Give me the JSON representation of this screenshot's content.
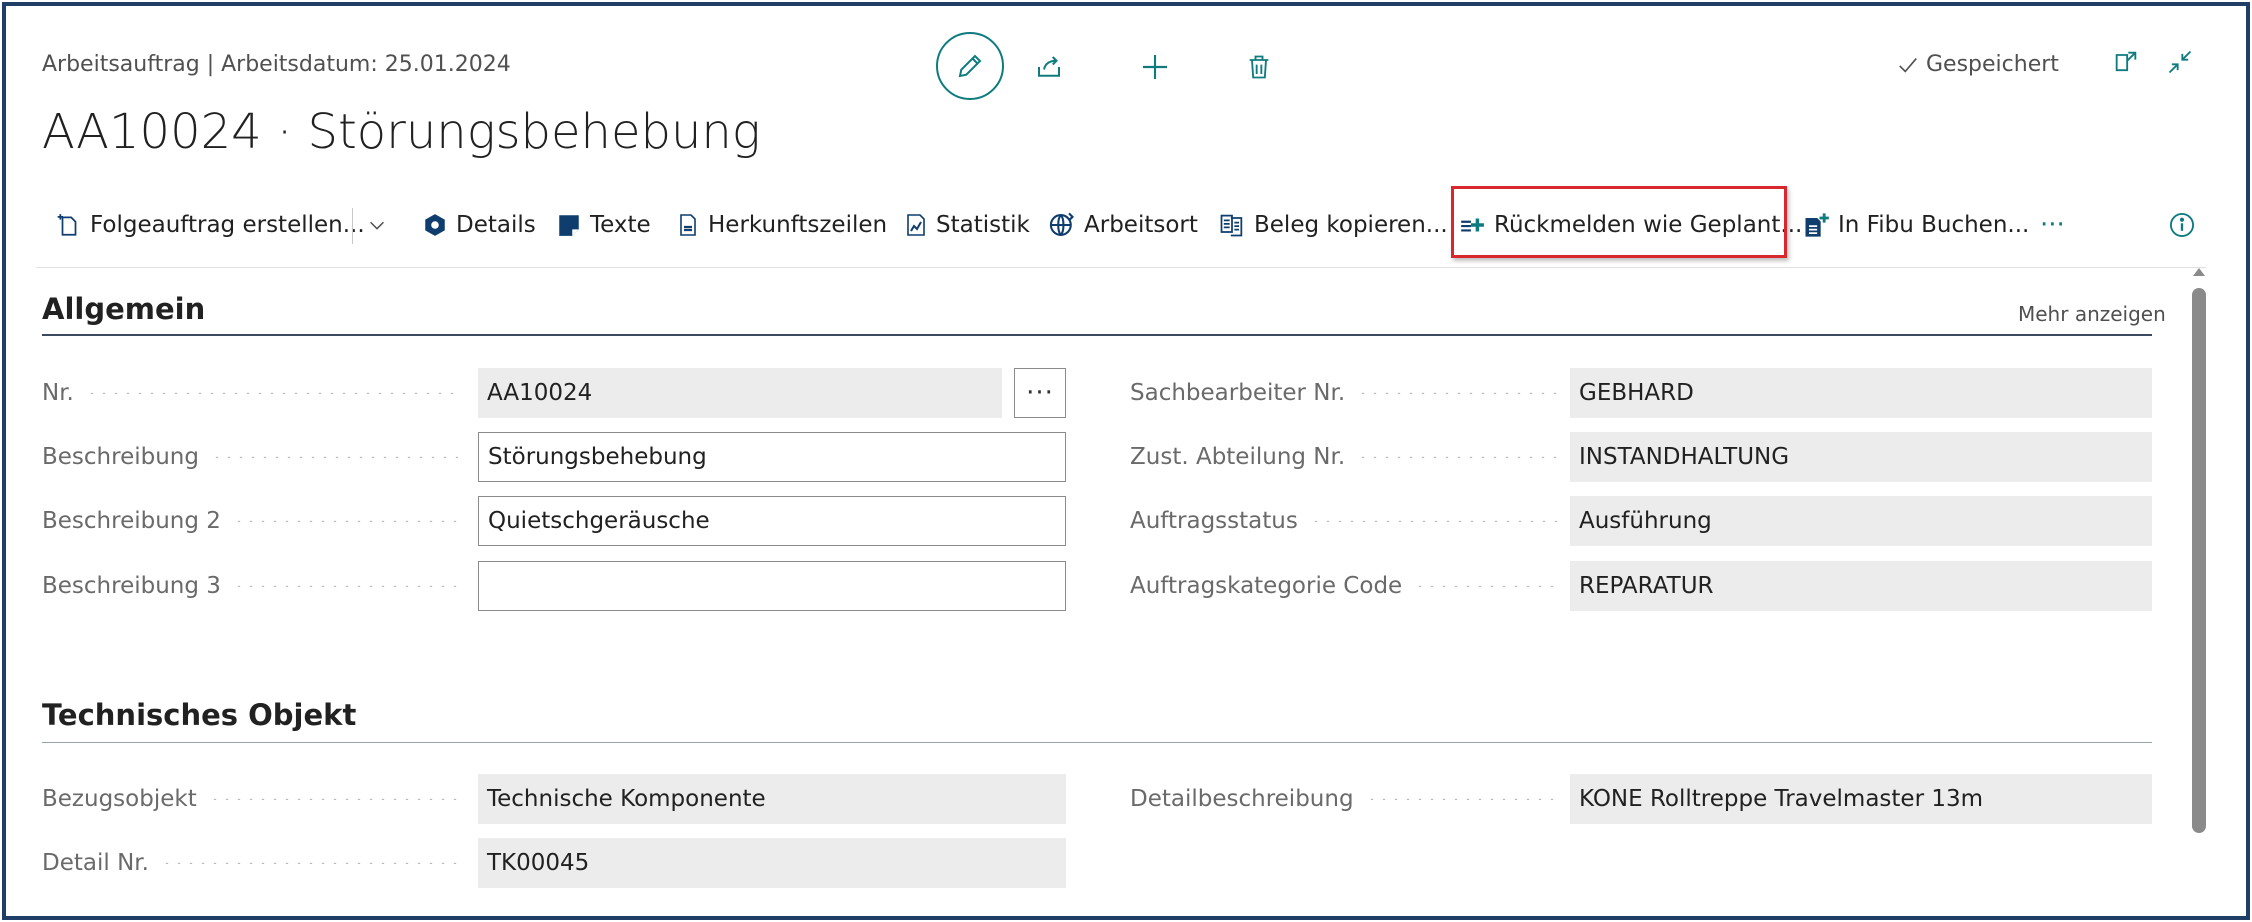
{
  "header": {
    "subtitle": "Arbeitsauftrag | Arbeitsdatum: 25.01.2024",
    "title": "AA10024 · Störungsbehebung",
    "saved_label": "Gespeichert"
  },
  "toolbar": {
    "items": [
      {
        "label": "Folgeauftrag erstellen...",
        "icon": "new-document-icon"
      },
      {
        "label": "Details",
        "icon": "hexagon-icon"
      },
      {
        "label": "Texte",
        "icon": "note-icon"
      },
      {
        "label": "Herkunftszeilen",
        "icon": "document-lines-icon"
      },
      {
        "label": "Statistik",
        "icon": "chart-document-icon"
      },
      {
        "label": "Arbeitsort",
        "icon": "globe-icon"
      },
      {
        "label": "Beleg kopieren...",
        "icon": "copy-document-icon"
      },
      {
        "label": "Rückmelden wie Geplant...",
        "icon": "add-lines-icon"
      },
      {
        "label": "In Fibu Buchen...",
        "icon": "post-document-icon"
      }
    ],
    "more_label": "···"
  },
  "allgemein": {
    "title": "Allgemein",
    "more_label": "Mehr anzeigen",
    "left": [
      {
        "label": "Nr.",
        "value": "AA10024"
      },
      {
        "label": "Beschreibung",
        "value": "Störungsbehebung"
      },
      {
        "label": "Beschreibung 2",
        "value": "Quietschgeräusche"
      },
      {
        "label": "Beschreibung 3",
        "value": ""
      }
    ],
    "right": [
      {
        "label": "Sachbearbeiter Nr.",
        "value": "GEBHARD"
      },
      {
        "label": "Zust. Abteilung Nr.",
        "value": "INSTANDHALTUNG"
      },
      {
        "label": "Auftragsstatus",
        "value": "Ausführung"
      },
      {
        "label": "Auftragskategorie Code",
        "value": "REPARATUR"
      }
    ],
    "assist_label": "···"
  },
  "technisches_objekt": {
    "title": "Technisches Objekt",
    "left": [
      {
        "label": "Bezugsobjekt",
        "value": "Technische Komponente"
      },
      {
        "label": "Detail Nr.",
        "value": "TK00045"
      }
    ],
    "right": [
      {
        "label": "Detailbeschreibung",
        "value": "KONE Rolltreppe Travelmaster 13m"
      }
    ]
  },
  "colors": {
    "accent": "#0f7b7f",
    "highlight": "#d9272e",
    "field_bg": "#ececec",
    "border": "#1f3f66"
  }
}
